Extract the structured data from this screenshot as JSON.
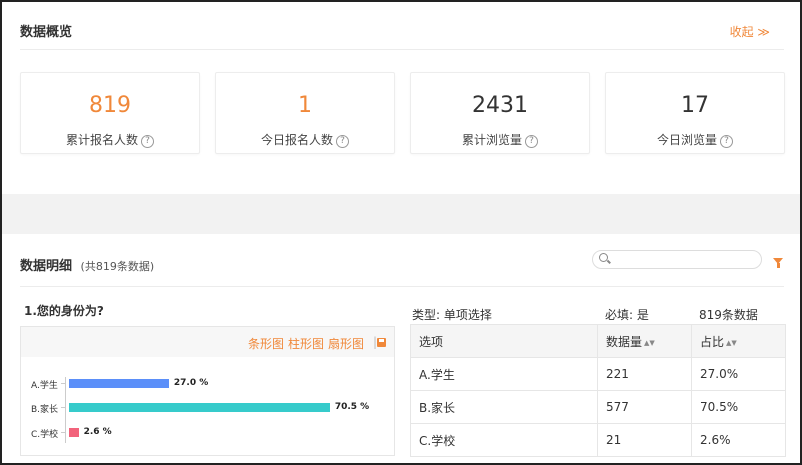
{
  "overview": {
    "title": "数据概览",
    "collapse_label": "收起 ≫",
    "stats": [
      {
        "value": "819",
        "label": "累计报名人数"
      },
      {
        "value": "1",
        "label": "今日报名人数"
      },
      {
        "value": "2431",
        "label": "累计浏览量"
      },
      {
        "value": "17",
        "label": "今日浏览量"
      }
    ],
    "help_glyph": "?"
  },
  "detail": {
    "title": "数据明细",
    "subtitle": "(共819条数据)",
    "search_placeholder": ""
  },
  "question": {
    "title": "1.您的身份为?",
    "type_label": "类型: 单项选择",
    "required_label": "必填: 是",
    "count_label": "819条数据"
  },
  "chart_controls": {
    "bar_h": "条形图",
    "bar_v": "柱形图",
    "pie": "扇形图",
    "sep": "|"
  },
  "chart_data": {
    "type": "bar",
    "orientation": "horizontal",
    "categories": [
      "A.学生",
      "B.家长",
      "C.学校"
    ],
    "values": [
      27.0,
      70.5,
      2.6
    ],
    "value_labels": [
      "27.0 %",
      "70.5 %",
      "2.6 %"
    ],
    "colors": [
      "#5b8ff9",
      "#36cbcb",
      "#f2637b"
    ],
    "xlim": [
      0,
      100
    ]
  },
  "table": {
    "headers": [
      "选项",
      "数据量",
      "占比"
    ],
    "rows": [
      [
        "A.学生",
        "221",
        "27.0%"
      ],
      [
        "B.家长",
        "577",
        "70.5%"
      ],
      [
        "C.学校",
        "21",
        "2.6%"
      ]
    ]
  },
  "colors": {
    "accent": "#f0883a"
  }
}
